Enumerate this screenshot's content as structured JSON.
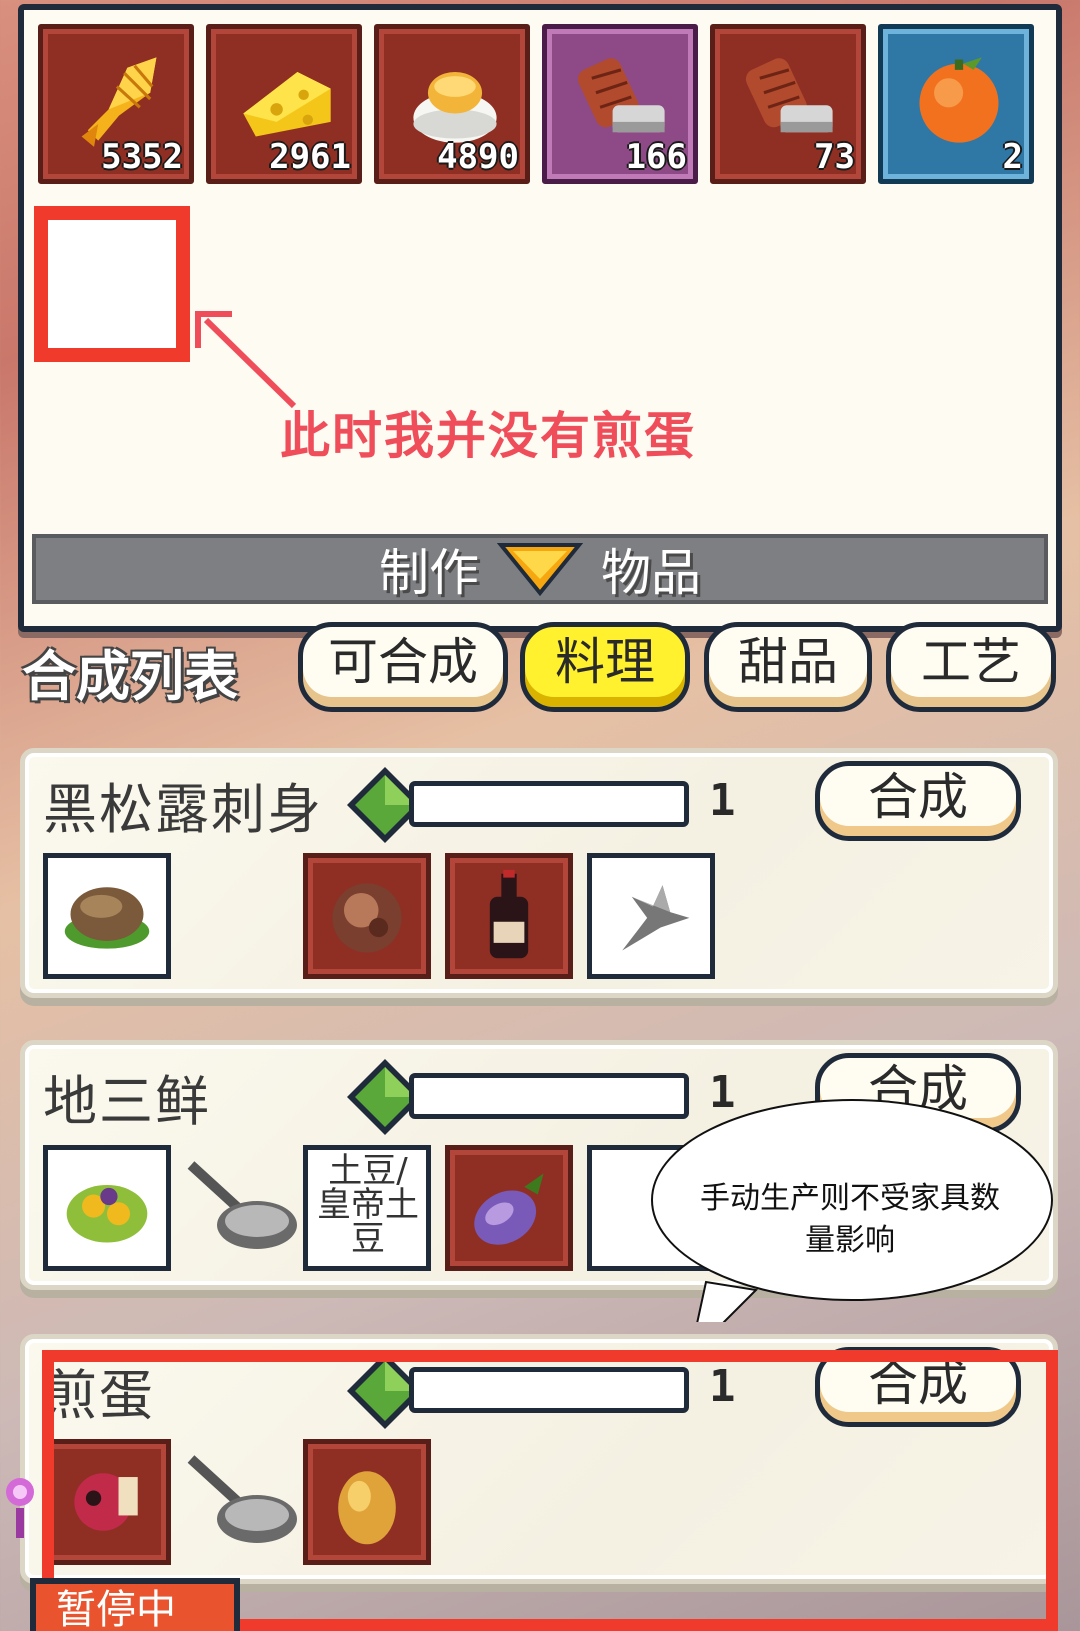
{
  "inventory": {
    "slots": [
      {
        "name": "ingredient-grilled-fish",
        "count": "5352",
        "frame": "red"
      },
      {
        "name": "ingredient-cheese",
        "count": "2961",
        "frame": "red"
      },
      {
        "name": "ingredient-custard",
        "count": "4890",
        "frame": "red"
      },
      {
        "name": "ingredient-sausage-rare",
        "count": "166",
        "frame": "purple"
      },
      {
        "name": "ingredient-sausage",
        "count": "73",
        "frame": "red"
      },
      {
        "name": "ingredient-orange",
        "count": "2",
        "frame": "blue"
      }
    ],
    "annotation": "此时我并没有煎蛋",
    "make_bar": {
      "left": "制作",
      "right": "物品"
    }
  },
  "list_title": "合成列表",
  "tabs": [
    {
      "label": "可合成",
      "active": false
    },
    {
      "label": "料理",
      "active": true
    },
    {
      "label": "甜品",
      "active": false
    },
    {
      "label": "工艺",
      "active": false
    }
  ],
  "recipes": [
    {
      "name": "黑松露刺身",
      "quantity": "1",
      "craft_label": "合成",
      "ingredients": [
        "black-truffle",
        "red-wine",
        "herb-leaf"
      ]
    },
    {
      "name": "地三鲜",
      "quantity": "1",
      "craft_label": "合成",
      "ingredients": [
        "frying-pan",
        "土豆/皇帝土豆",
        "eggplant"
      ]
    },
    {
      "name": "煎蛋",
      "quantity": "1",
      "craft_label": "合成",
      "ingredients": [
        "frying-pan",
        "egg"
      ]
    }
  ],
  "speech_bubble": "手动生产则不受家具数量影响",
  "bottom_tab": "暂停中",
  "colors": {
    "annotation_red": "#ef3a2c",
    "active_tab": "#fff12e",
    "slot_red": "#8f2f24",
    "slot_purple": "#8e4a86",
    "slot_blue": "#2f78a6"
  }
}
